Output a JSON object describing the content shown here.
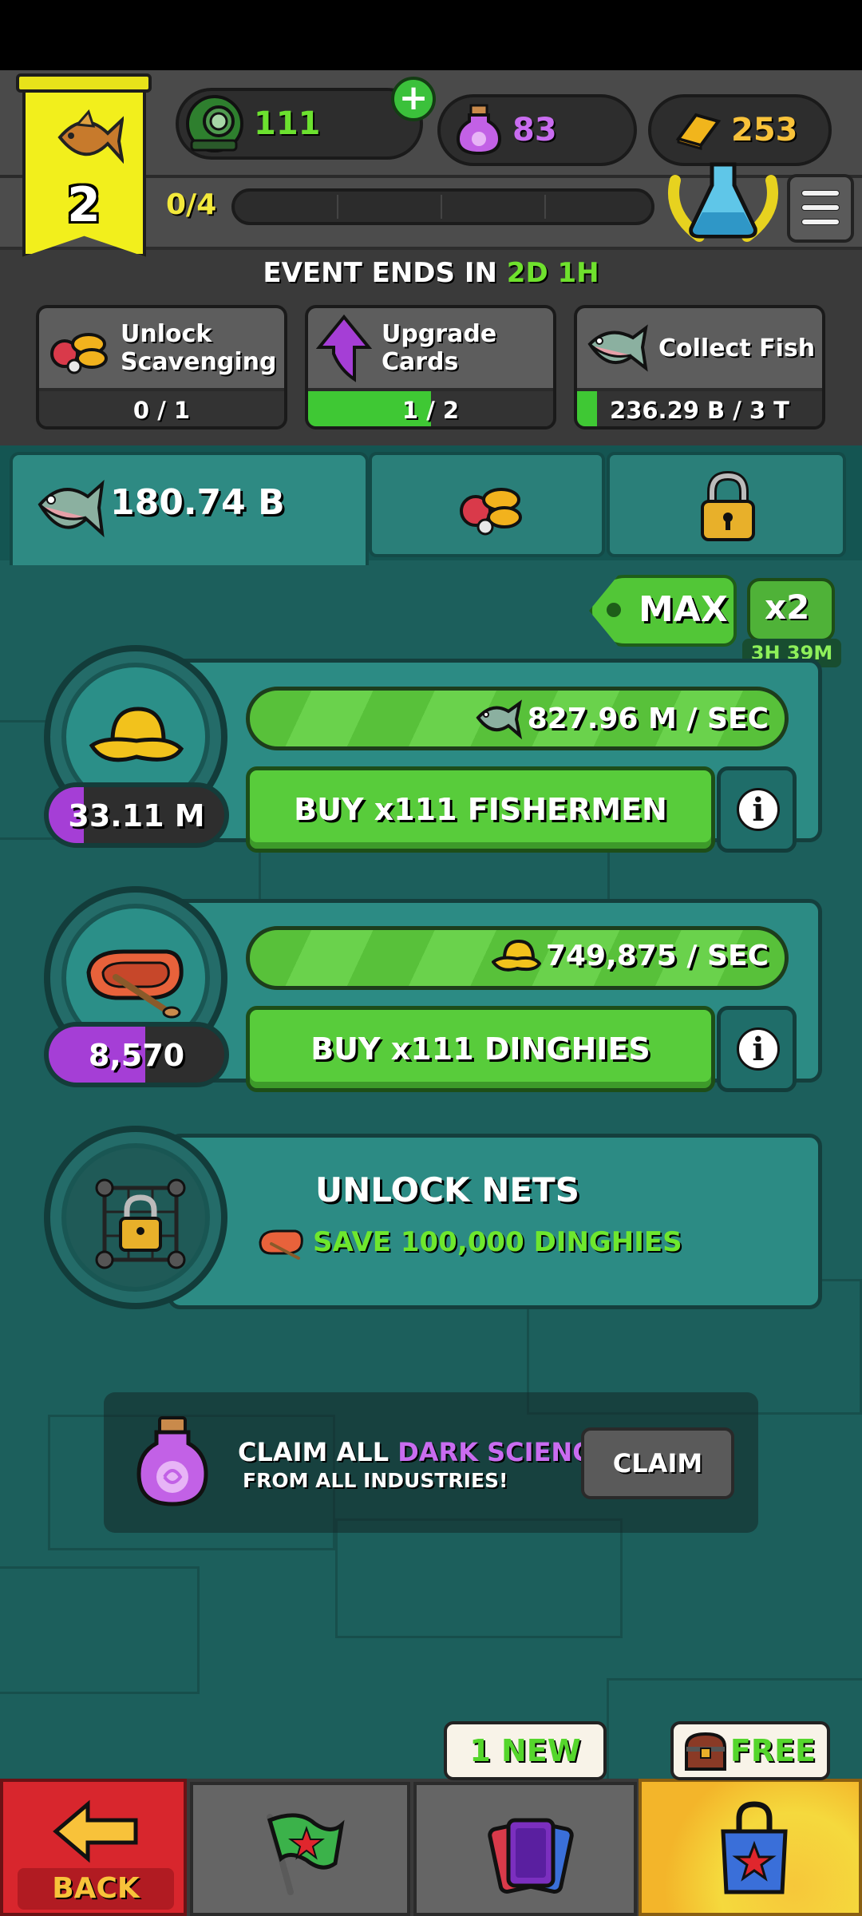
{
  "header": {
    "level": "2",
    "resources": {
      "helmets": "111",
      "potions": "83",
      "gold": "253"
    },
    "quest_progress": "0/4",
    "event": {
      "prefix": "EVENT ENDS IN",
      "time": "2D 1H"
    },
    "tasks": [
      {
        "label_line1": "Unlock",
        "label_line2": "Scavenging",
        "progress": "0 / 1",
        "fill": 0.0
      },
      {
        "label_line1": "Upgrade",
        "label_line2": "Cards",
        "progress": "1 / 2",
        "fill": 0.5
      },
      {
        "label_line1": "Collect Fish",
        "label_line2": "",
        "progress": "236.29 B / 3 T",
        "fill": 0.08
      }
    ]
  },
  "tabs": {
    "fish_amount": "180.74 B"
  },
  "boost": {
    "max_label": "MAX",
    "multiplier": "x2",
    "timer": "3H 39M"
  },
  "industries": [
    {
      "name": "fishermen",
      "rate": "827.96 M / SEC",
      "buy_label": "BUY x111 FISHERMEN",
      "owned": "33.11 M",
      "owned_fill": 0.2
    },
    {
      "name": "dinghies",
      "rate": "749,875 / SEC",
      "buy_label": "BUY x111 DINGHIES",
      "owned": "8,570",
      "owned_fill": 0.55
    }
  ],
  "locked": {
    "title": "UNLOCK NETS",
    "requirement": "SAVE 100,000 DINGHIES"
  },
  "claim": {
    "line1_prefix": "CLAIM ALL ",
    "line1_highlight": "DARK SCIENCE",
    "line2": "FROM ALL INDUSTRIES!",
    "button": "CLAIM"
  },
  "nav": {
    "back_label": "BACK",
    "cards_badge": "1 NEW",
    "shop_badge": "FREE"
  },
  "colors": {
    "accent_green": "#58cc3b",
    "accent_purple": "#a53ed6",
    "event_green": "#6fe12d",
    "level_yellow": "#f2ef1c"
  }
}
